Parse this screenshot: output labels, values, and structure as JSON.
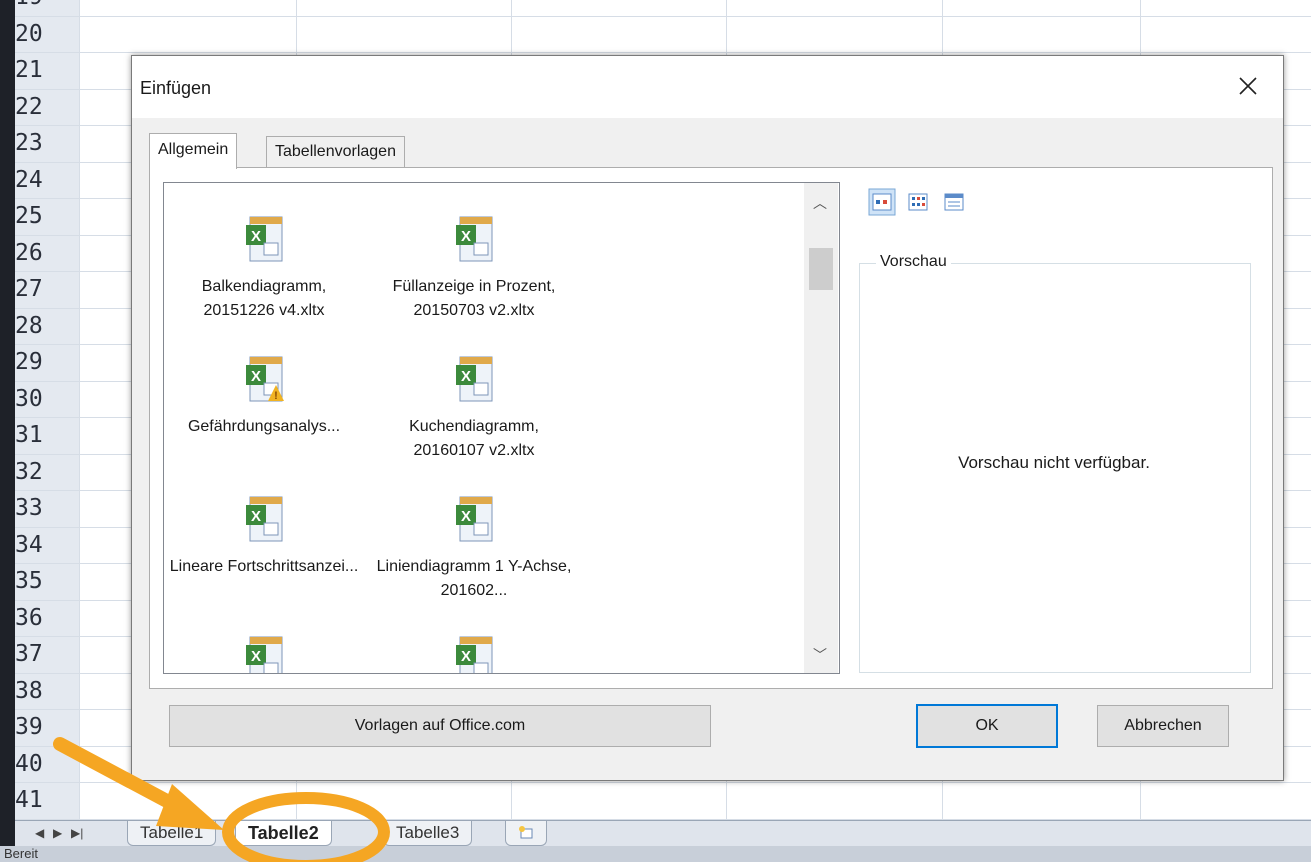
{
  "spreadsheet": {
    "row_numbers": [
      "19",
      "20",
      "21",
      "22",
      "23",
      "24",
      "25",
      "26",
      "27",
      "28",
      "29",
      "30",
      "31",
      "32",
      "33",
      "34",
      "35",
      "36",
      "37",
      "38",
      "39",
      "40",
      "41"
    ],
    "sheet_tabs": [
      {
        "label": "Tabelle1",
        "active": false
      },
      {
        "label": "Tabelle2",
        "active": true
      },
      {
        "label": "Tabelle3",
        "active": false
      }
    ],
    "status_text": "Bereit"
  },
  "dialog": {
    "title": "Einfügen",
    "tabs": [
      "Allgemein",
      "Tabellenvorlagen"
    ],
    "templates": [
      {
        "label": "Balkendiagramm, 20151226 v4.xltx",
        "icon": "excel-template-icon"
      },
      {
        "label": "Füllanzeige in Prozent, 20150703 v2.xltx",
        "icon": "excel-template-icon"
      },
      {
        "label": "Gefährdungsanalys...",
        "icon": "excel-template-warning-icon"
      },
      {
        "label": "Kuchendiagramm, 20160107 v2.xltx",
        "icon": "excel-template-icon"
      },
      {
        "label": "Lineare Fortschrittsanzei...",
        "icon": "excel-template-icon"
      },
      {
        "label": "Liniendiagramm 1 Y-Achse, 201602...",
        "icon": "excel-template-icon"
      }
    ],
    "view_buttons": [
      "large-icons-view-icon",
      "list-view-icon",
      "details-view-icon"
    ],
    "preview_label": "Vorschau",
    "preview_text": "Vorschau nicht verfügbar.",
    "office_button": "Vorlagen auf Office.com",
    "ok_button": "OK",
    "cancel_button": "Abbrechen"
  },
  "annotation": {
    "color": "#f5a623",
    "target": "Tabelle2"
  }
}
